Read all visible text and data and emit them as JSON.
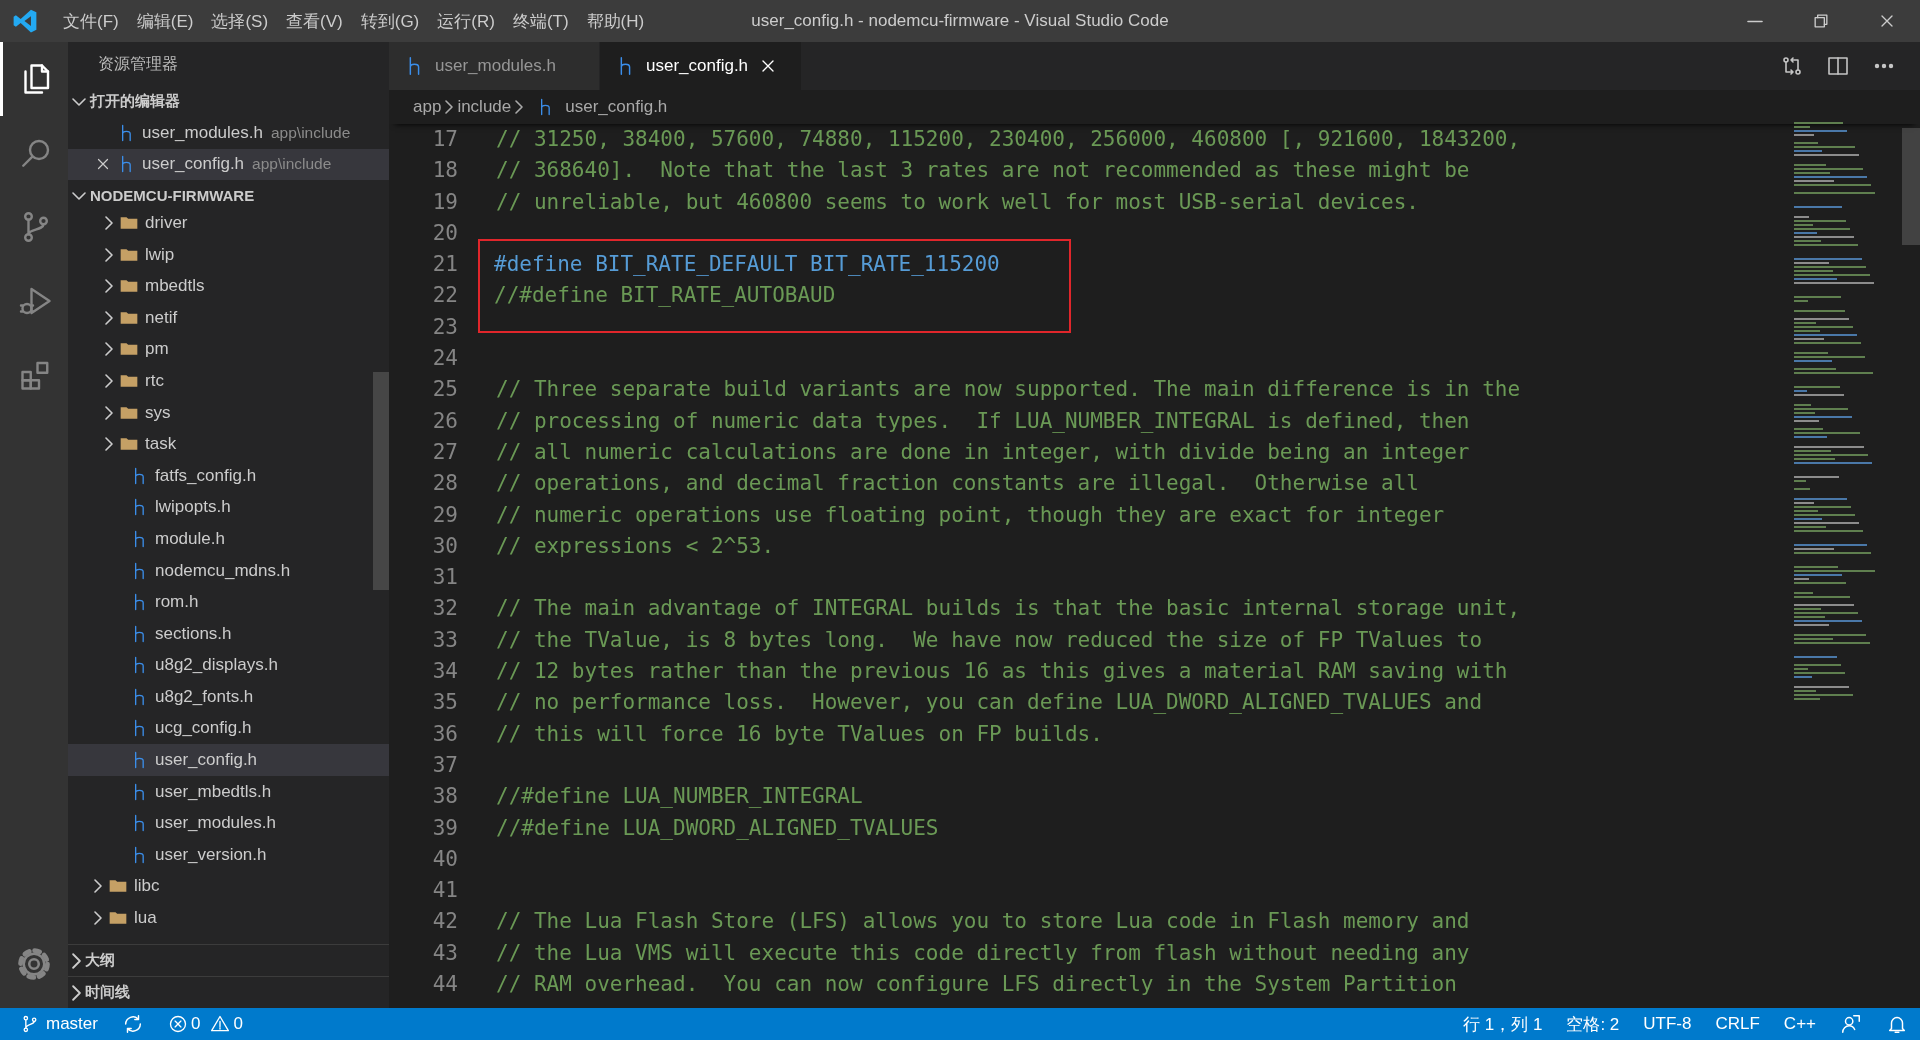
{
  "title_bar": {
    "menus": [
      "文件(F)",
      "编辑(E)",
      "选择(S)",
      "查看(V)",
      "转到(G)",
      "运行(R)",
      "终端(T)",
      "帮助(H)"
    ],
    "title": "user_config.h - nodemcu-firmware - Visual Studio Code"
  },
  "activity_bar": [
    {
      "kind": "explorer",
      "selected": true
    },
    {
      "kind": "search",
      "selected": false
    },
    {
      "kind": "source-control",
      "selected": false
    },
    {
      "kind": "run",
      "selected": false
    },
    {
      "kind": "extensions",
      "selected": false
    }
  ],
  "sidebar": {
    "title": "资源管理器",
    "open_editors": {
      "label": "打开的编辑器",
      "expanded": true,
      "items": [
        {
          "name": "user_modules.h",
          "path": "app\\include",
          "selected": false
        },
        {
          "name": "user_config.h",
          "path": "app\\include",
          "selected": true
        }
      ]
    },
    "folder": {
      "label": "NODEMCU-FIRMWARE",
      "expanded": true,
      "items": [
        {
          "kind": "offscreen-folder",
          "children": [
            {
              "kind": "folder",
              "name": "driver",
              "expanded": false
            },
            {
              "kind": "folder",
              "name": "lwip",
              "expanded": false
            },
            {
              "kind": "folder",
              "name": "mbedtls",
              "expanded": false
            },
            {
              "kind": "folder",
              "name": "netif",
              "expanded": false
            },
            {
              "kind": "folder",
              "name": "pm",
              "expanded": false
            },
            {
              "kind": "folder",
              "name": "rtc",
              "expanded": false
            },
            {
              "kind": "folder",
              "name": "sys",
              "expanded": false
            },
            {
              "kind": "folder",
              "name": "task",
              "expanded": false
            },
            {
              "kind": "file",
              "name": "fatfs_config.h",
              "selected": false
            },
            {
              "kind": "file",
              "name": "lwipopts.h",
              "selected": false
            },
            {
              "kind": "file",
              "name": "module.h",
              "selected": false
            },
            {
              "kind": "file",
              "name": "nodemcu_mdns.h",
              "selected": false
            },
            {
              "kind": "file",
              "name": "rom.h",
              "selected": false
            },
            {
              "kind": "file",
              "name": "sections.h",
              "selected": false
            },
            {
              "kind": "file",
              "name": "u8g2_displays.h",
              "selected": false
            },
            {
              "kind": "file",
              "name": "u8g2_fonts.h",
              "selected": false
            },
            {
              "kind": "file",
              "name": "ucg_config.h",
              "selected": false
            },
            {
              "kind": "file",
              "name": "user_config.h",
              "selected": true
            },
            {
              "kind": "file",
              "name": "user_mbedtls.h",
              "selected": false
            },
            {
              "kind": "file",
              "name": "user_modules.h",
              "selected": false
            },
            {
              "kind": "file",
              "name": "user_version.h",
              "selected": false
            }
          ]
        },
        {
          "kind": "folder",
          "name": "libc",
          "expanded": false
        },
        {
          "kind": "folder",
          "name": "lua",
          "expanded": false
        }
      ]
    },
    "sections": [
      {
        "label": "大纲",
        "expanded": false
      },
      {
        "label": "时间线",
        "expanded": false
      }
    ]
  },
  "editor": {
    "tabs": [
      {
        "name": "user_modules.h",
        "selected": false
      },
      {
        "name": "user_config.h",
        "selected": true
      }
    ],
    "breadcrumb": [
      "app",
      "include",
      "user_config.h"
    ],
    "lines": [
      {
        "number": "17",
        "kind": "comment",
        "text": "// 31250, 38400, 57600, 74880, 115200, 230400, 256000, 460800 [, 921600, 1843200,",
        "boxed": false
      },
      {
        "number": "18",
        "kind": "comment",
        "text": "// 368640].  Note that the last 3 rates are not recommended as these might be",
        "boxed": false
      },
      {
        "number": "19",
        "kind": "comment",
        "text": "// unreliable, but 460800 seems to work well for most USB-serial devices.",
        "boxed": false
      },
      {
        "number": "20",
        "kind": "blank",
        "boxed": false
      },
      {
        "number": "21",
        "kind": "directive",
        "text": "#define BIT_RATE_DEFAULT BIT_RATE_115200",
        "boxed": true
      },
      {
        "number": "22",
        "kind": "comment",
        "text": "//#define BIT_RATE_AUTOBAUD",
        "boxed": true
      },
      {
        "number": "23",
        "kind": "blank",
        "boxed": false
      },
      {
        "number": "24",
        "kind": "blank",
        "boxed": false
      },
      {
        "number": "25",
        "kind": "comment",
        "text": "// Three separate build variants are now supported. The main difference is in the",
        "boxed": false
      },
      {
        "number": "26",
        "kind": "comment",
        "text": "// processing of numeric data types.  If LUA_NUMBER_INTEGRAL is defined, then",
        "boxed": false
      },
      {
        "number": "27",
        "kind": "comment",
        "text": "// all numeric calculations are done in integer, with divide being an integer",
        "boxed": false
      },
      {
        "number": "28",
        "kind": "comment",
        "text": "// operations, and decimal fraction constants are illegal.  Otherwise all",
        "boxed": false
      },
      {
        "number": "29",
        "kind": "comment",
        "text": "// numeric operations use floating point, though they are exact for integer",
        "boxed": false
      },
      {
        "number": "30",
        "kind": "comment",
        "text": "// expressions < 2^53.",
        "boxed": false
      },
      {
        "number": "31",
        "kind": "blank",
        "boxed": false
      },
      {
        "number": "32",
        "kind": "comment",
        "text": "// The main advantage of INTEGRAL builds is that the basic internal storage unit,",
        "boxed": false
      },
      {
        "number": "33",
        "kind": "comment",
        "text": "// the TValue, is 8 bytes long.  We have now reduced the size of FP TValues to",
        "boxed": false
      },
      {
        "number": "34",
        "kind": "comment",
        "text": "// 12 bytes rather than the previous 16 as this gives a material RAM saving with",
        "boxed": false
      },
      {
        "number": "35",
        "kind": "comment",
        "text": "// no performance loss.  However, you can define LUA_DWORD_ALIGNED_TVALUES and",
        "boxed": false
      },
      {
        "number": "36",
        "kind": "comment",
        "text": "// this will force 16 byte TValues on FP builds.",
        "boxed": false
      },
      {
        "number": "37",
        "kind": "blank",
        "boxed": false
      },
      {
        "number": "38",
        "kind": "comment",
        "text": "//#define LUA_NUMBER_INTEGRAL",
        "boxed": false
      },
      {
        "number": "39",
        "kind": "comment",
        "text": "//#define LUA_DWORD_ALIGNED_TVALUES",
        "boxed": false
      },
      {
        "number": "40",
        "kind": "blank",
        "boxed": false
      },
      {
        "number": "41",
        "kind": "blank",
        "boxed": false
      },
      {
        "number": "42",
        "kind": "comment",
        "text": "// The Lua Flash Store (LFS) allows you to store Lua code in Flash memory and",
        "boxed": false
      },
      {
        "number": "43",
        "kind": "comment",
        "text": "// the Lua VMS will execute this code directly from flash without needing any",
        "boxed": false
      },
      {
        "number": "44",
        "kind": "comment",
        "text": "// RAM overhead.  You can now configure LFS directly in the System Partition",
        "boxed": false
      }
    ]
  },
  "status_bar": {
    "branch": "master",
    "errors": "0",
    "warnings": "0",
    "position": "行 1，列 1",
    "indentation": "空格: 2",
    "encoding": "UTF-8",
    "line_ending": "CRLF",
    "language": "C++"
  }
}
